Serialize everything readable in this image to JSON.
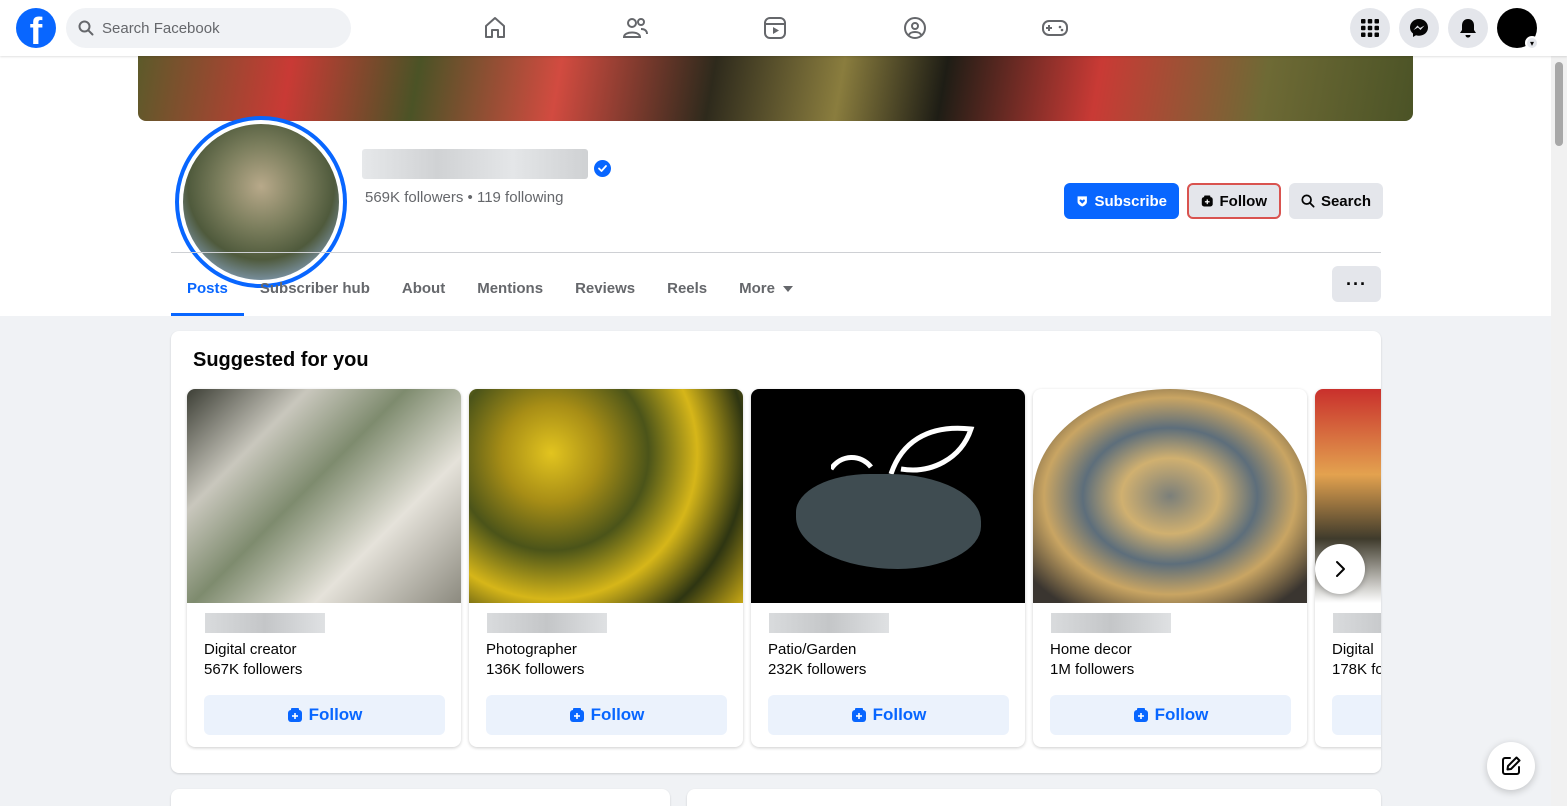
{
  "topbar": {
    "search_placeholder": "Search Facebook",
    "logo_letter": "f",
    "nav": [
      "home-icon",
      "friends-icon",
      "video-icon",
      "groups-icon",
      "gaming-icon"
    ],
    "right": [
      "menu-grid-icon",
      "messenger-icon",
      "notifications-icon",
      "account-avatar"
    ]
  },
  "profile": {
    "follow_stats": "569K followers • 119 following",
    "actions": {
      "subscribe_label": "Subscribe",
      "follow_label": "Follow",
      "search_label": "Search"
    },
    "more_label": "···"
  },
  "tabs": [
    {
      "label": "Posts",
      "active": true
    },
    {
      "label": "Subscriber hub"
    },
    {
      "label": "About"
    },
    {
      "label": "Mentions"
    },
    {
      "label": "Reviews"
    },
    {
      "label": "Reels"
    },
    {
      "label": "More"
    }
  ],
  "suggested": {
    "title": "Suggested for you",
    "follow_label": "Follow",
    "cards": [
      {
        "category": "Digital creator",
        "followers": "567K followers"
      },
      {
        "category": "Photographer",
        "followers": "136K followers"
      },
      {
        "category": "Patio/Garden",
        "followers": "232K followers"
      },
      {
        "category": "Home decor",
        "followers": "1M followers"
      },
      {
        "category": "Digital",
        "followers": "178K fo"
      }
    ]
  },
  "colors": {
    "brand": "#0866ff",
    "follow_highlight": "#d9534f"
  }
}
